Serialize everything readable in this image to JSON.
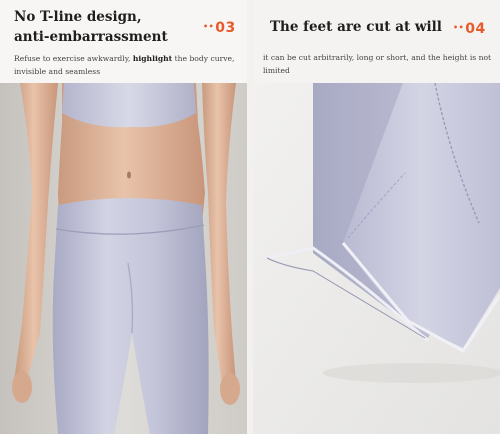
{
  "panels": [
    {
      "title_line1": "No T-line design,",
      "title_line2": "anti-embarrassment",
      "desc_part1": "Refuse to exercise awkwardly, ",
      "desc_highlight": "highlight",
      "desc_part2": " the body curve, invisible and seamless",
      "badge_dots": "••",
      "badge_number": "03",
      "badge_color": "#e85a2a"
    },
    {
      "title": "The feet are cut at will",
      "desc": "it can be cut arbitrarily, long or short, and the height is not limited",
      "badge_dots": "••",
      "badge_number": "04",
      "badge_color": "#e85a2a"
    }
  ],
  "colors": {
    "fabric": "#c9cadd",
    "fabric_shadow": "#a9aac4",
    "fabric_light": "#dcdde9",
    "skin": "#e0b79d",
    "skin_shadow": "#c99a7e",
    "background_photo": "#d9d7d3"
  }
}
